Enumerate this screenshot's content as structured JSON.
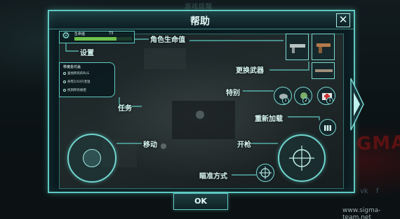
{
  "background": {
    "title": "游戏提醒",
    "watermark": "www.sigma-team.net",
    "red_word": "GMA",
    "social": [
      "vk",
      "f"
    ]
  },
  "dialog": {
    "title": "帮助",
    "close_symbol": "✕",
    "ok_label": "OK"
  },
  "hud": {
    "health_label": "生命值",
    "health_value": "73",
    "health_fraction": 0.73,
    "mission_title": "移魔金坊盖",
    "missions": [
      "查找所有的RLS",
      "杀死2/10只老鼠",
      "找到所有秘密"
    ],
    "special_counts": [
      "1",
      "2",
      "1"
    ]
  },
  "callouts": {
    "health": "角色生命值",
    "settings": "设置",
    "switch_weapon": "更换武器",
    "special": "特别",
    "mission": "任务",
    "reload": "重新加载",
    "move": "移动",
    "fire": "开枪",
    "aim_mode": "瞄准方式"
  },
  "colors": {
    "accent": "#5fc9c2",
    "panel_bg": "#0b1b21",
    "text": "#d8f7f2",
    "health_bar": "#6ec24a"
  },
  "icons": {
    "settings": "gear-icon",
    "close": "close-icon",
    "weapons": [
      "rifle-icon",
      "pistol-icon",
      "shotgun-icon"
    ],
    "special": [
      "grenade-icon",
      "mine-icon",
      "medkit-icon"
    ],
    "reload": "ammo-icon",
    "aim": "crosshair-icon",
    "next": "chevron-right-icon"
  }
}
